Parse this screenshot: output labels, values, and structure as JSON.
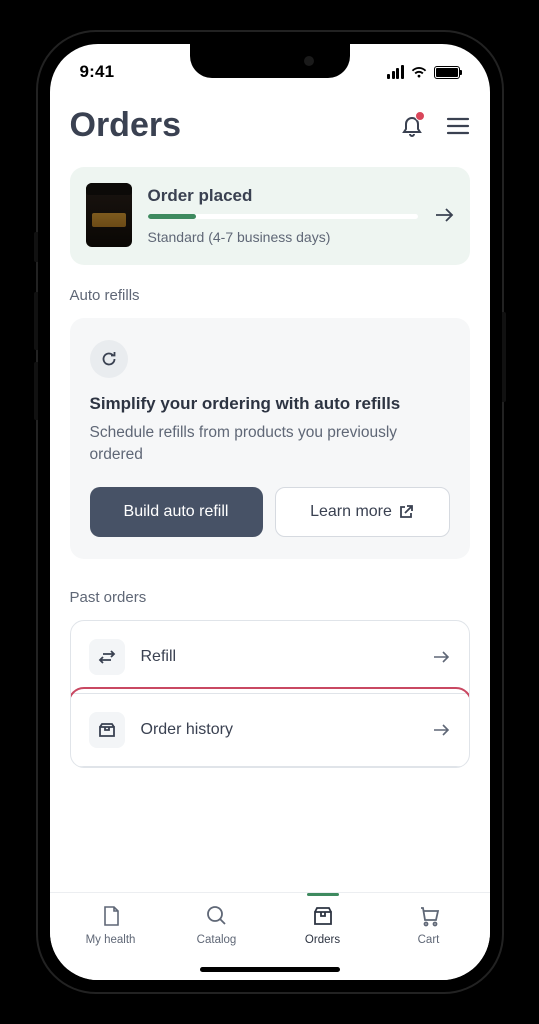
{
  "status_bar": {
    "time": "9:41"
  },
  "header": {
    "title": "Orders"
  },
  "order": {
    "status": "Order placed",
    "shipping": "Standard (4-7 business days)"
  },
  "sections": {
    "auto_refills_label": "Auto refills",
    "past_orders_label": "Past orders"
  },
  "auto_refill": {
    "title": "Simplify your ordering with auto refills",
    "desc": "Schedule refills from products you previously ordered",
    "build_btn": "Build auto refill",
    "learn_btn": "Learn more"
  },
  "past": {
    "refill": "Refill",
    "history": "Order history"
  },
  "tabs": {
    "health": "My health",
    "catalog": "Catalog",
    "orders": "Orders",
    "cart": "Cart"
  },
  "colors": {
    "accent_green": "#3e8a5f",
    "btn_dark": "#475266",
    "text_primary": "#3a4151",
    "text_secondary": "#5f6776",
    "highlight": "#c94862"
  }
}
